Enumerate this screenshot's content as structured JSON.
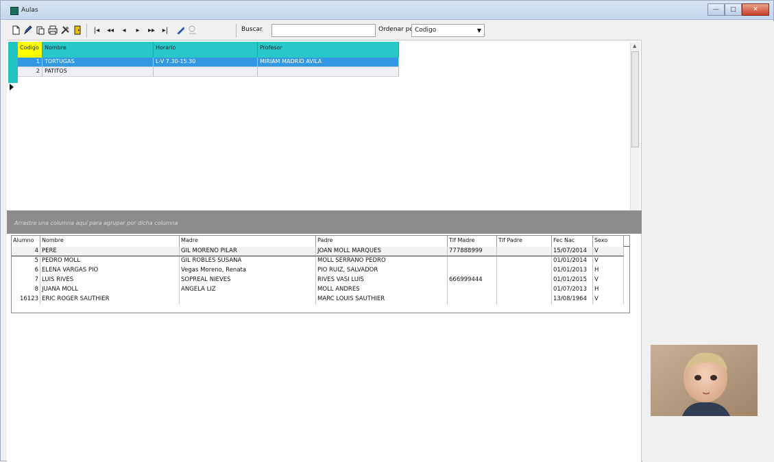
{
  "window": {
    "title": "Aulas",
    "buttons": [
      "—",
      "□",
      "✕"
    ]
  },
  "toolbar": {
    "buscar_label": "Buscar",
    "buscar_value": "",
    "ordenar_label": "Ordenar por",
    "ordenar_value": "Codigo"
  },
  "aulas_grid": {
    "columns": [
      "Codigo",
      "Nombre",
      "Horario",
      "Profesor"
    ],
    "rows": [
      {
        "codigo": "1",
        "nombre": "TORTUGAS",
        "horario": "L-V 7.30-15.30",
        "profesor": "MIRIAM MADRID AVILA"
      },
      {
        "codigo": "2",
        "nombre": "PATITOS",
        "horario": "",
        "profesor": ""
      }
    ]
  },
  "group_panel": {
    "text": "Arrastre una columna aquí para agrupar por dicha columna"
  },
  "alumnos_grid": {
    "columns": [
      "Alumno",
      "Nombre",
      "Madre",
      "Padre",
      "Tlf Madre",
      "Tlf Padre",
      "Fec Nac",
      "Sexo"
    ],
    "rows": [
      {
        "alumno": "4",
        "nombre": "PERE",
        "madre": "GIL MORENO PILAR",
        "padre": "JOAN MOLL MARQUES",
        "tlf_madre": "777888999",
        "tlf_padre": "",
        "fec_nac": "15/07/2014",
        "sexo": "V"
      },
      {
        "alumno": "5",
        "nombre": "PEDRO MOLL",
        "madre": "GIL ROBLES SUSANA",
        "padre": "MOLL SERRANO PEDRO",
        "tlf_madre": "",
        "tlf_padre": "",
        "fec_nac": "01/01/2014",
        "sexo": "V"
      },
      {
        "alumno": "6",
        "nombre": "ELENA VARGAS PIO",
        "madre": "Vegas Moreno, Renata",
        "padre": "PIO RUIZ, SALVADOR",
        "tlf_madre": "",
        "tlf_padre": "",
        "fec_nac": "01/01/2013",
        "sexo": "H"
      },
      {
        "alumno": "7",
        "nombre": "LUIS RIVES",
        "madre": "SOPREAL NIEVES",
        "padre": "RIVES VASI LUIS",
        "tlf_madre": "666999444",
        "tlf_padre": "",
        "fec_nac": "01/01/2015",
        "sexo": "V"
      },
      {
        "alumno": "8",
        "nombre": "JUANA MOLL",
        "madre": "ANGELA LIZ",
        "padre": "MOLL ANDRES",
        "tlf_madre": "",
        "tlf_padre": "",
        "fec_nac": "01/07/2013",
        "sexo": "H"
      },
      {
        "alumno": "16123",
        "nombre": "ERIC ROGER SAUTHIER",
        "madre": "",
        "padre": "MARC LOUIS SAUTHIER",
        "tlf_madre": "",
        "tlf_padre": "",
        "fec_nac": "13/08/1964",
        "sexo": "V"
      }
    ]
  },
  "icons": {
    "toolbar": [
      "new-doc-icon",
      "edit-icon",
      "copy-icon",
      "print-icon",
      "tools-icon",
      "exit-icon",
      "first-icon",
      "prev-page-icon",
      "prev-icon",
      "next-icon",
      "next-page-icon",
      "last-icon",
      "apply-icon",
      "filter-icon"
    ]
  }
}
